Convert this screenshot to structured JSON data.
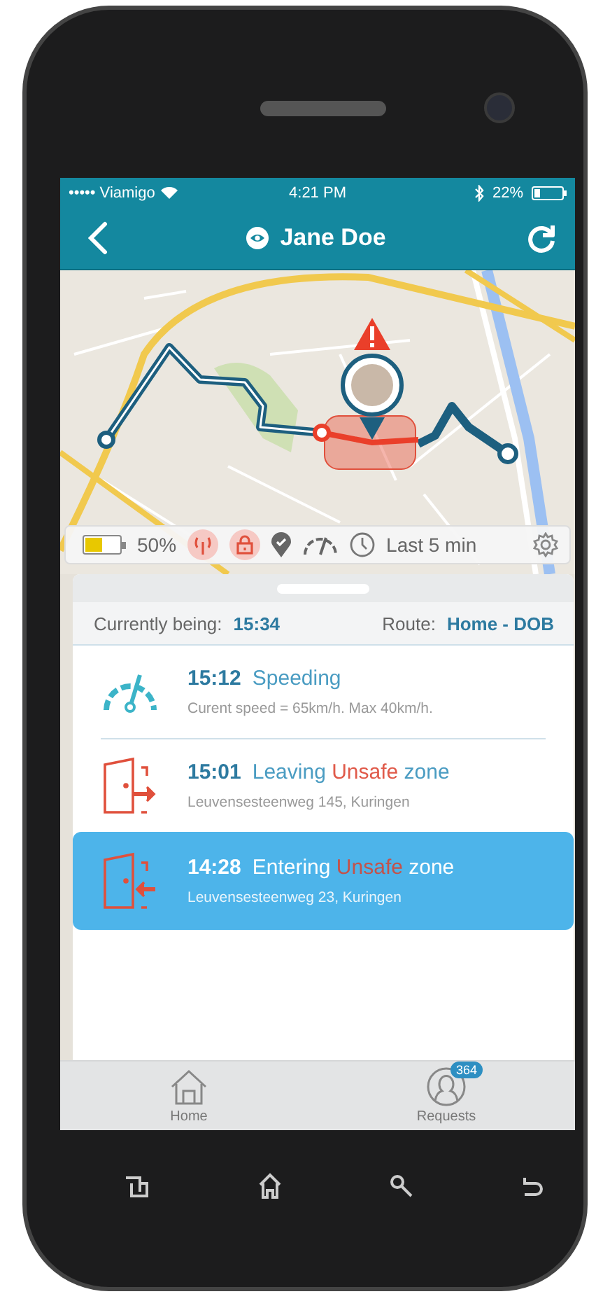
{
  "status_bar": {
    "carrier": "••••• Viamigo",
    "time": "4:21 PM",
    "battery": "22%",
    "battery_meter": {
      "level": 0.22
    }
  },
  "nav": {
    "title": "Jane Doe"
  },
  "map_info": {
    "battery": "50%",
    "level": 0.5,
    "signal_alert": true,
    "lock_alert": true,
    "last_update": "Last 5 min"
  },
  "summary": {
    "label": "Currently being:",
    "value": "15:34",
    "route_label": "Route:",
    "route": "Home - DOB"
  },
  "events": [
    {
      "kind": "speeding",
      "time": "15:12",
      "title": [
        {
          "text": "Speeding",
          "alert": false
        }
      ],
      "detail": "Curent speed = 65km/h. Max 40km/h.",
      "selected": false
    },
    {
      "kind": "leaving",
      "time": "15:01",
      "title": [
        {
          "text": "Leaving",
          "alert": false
        },
        {
          "text": "Unsafe",
          "alert": true
        },
        {
          "text": "zone",
          "alert": false
        }
      ],
      "detail": "Leuvensesteenweg 145, Kuringen",
      "selected": false
    },
    {
      "kind": "entering",
      "time": "14:28",
      "title": [
        {
          "text": "Entering",
          "alert": false
        },
        {
          "text": "Unsafe",
          "alert": true
        },
        {
          "text": "zone",
          "alert": false
        }
      ],
      "detail": "Leuvensesteenweg 23, Kuringen",
      "selected": true
    }
  ],
  "tabs": [
    {
      "kind": "home",
      "label": "Home",
      "selected": false
    },
    {
      "kind": "requests",
      "label": "Requests",
      "selected": false,
      "badge": "364"
    }
  ]
}
